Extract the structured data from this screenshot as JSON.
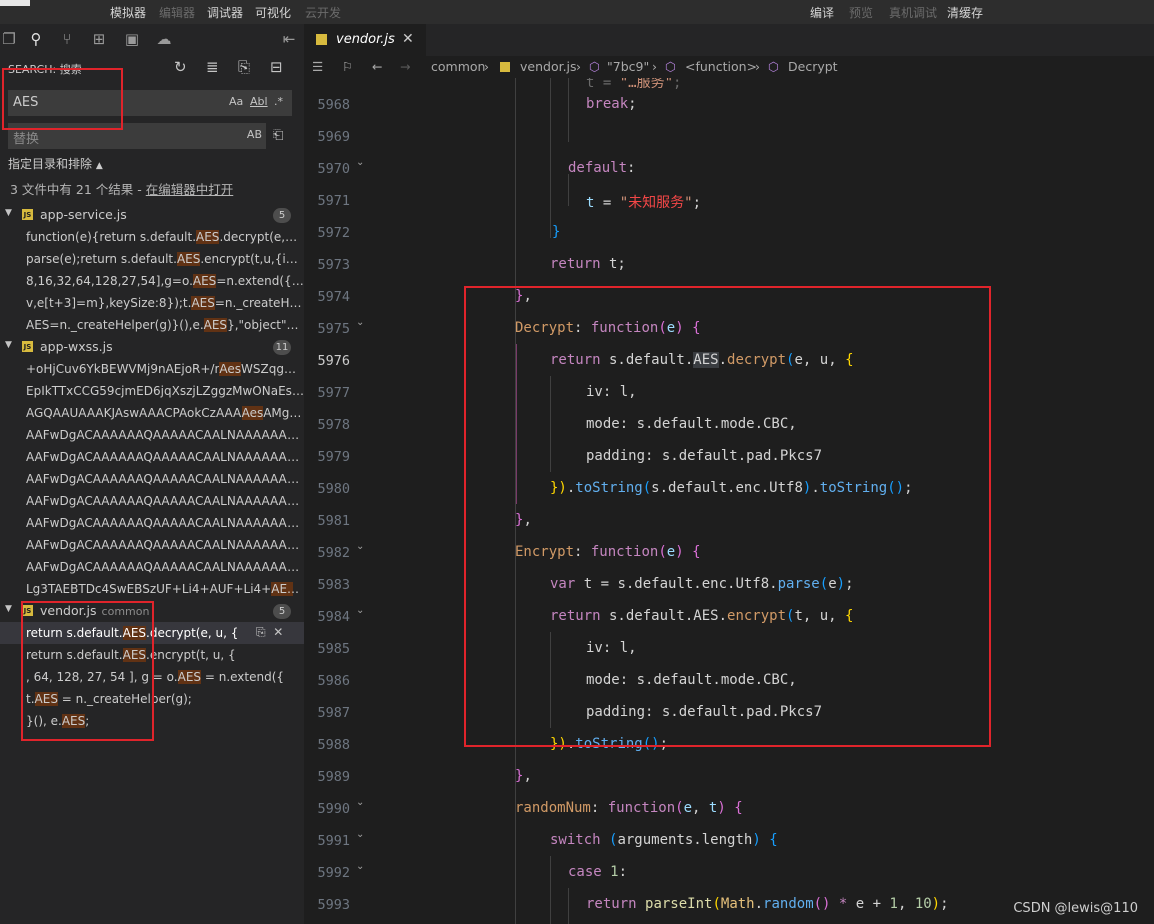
{
  "menubar": {
    "left": [
      {
        "label": "模拟器",
        "enabled": true
      },
      {
        "label": "编辑器",
        "enabled": false
      },
      {
        "label": "调试器",
        "enabled": true
      },
      {
        "label": "可视化",
        "enabled": true
      },
      {
        "label": "云开发",
        "enabled": false
      }
    ],
    "right": [
      {
        "label": "编译",
        "enabled": true
      },
      {
        "label": "预览",
        "enabled": false
      },
      {
        "label": "真机调试",
        "enabled": false
      },
      {
        "label": "清缓存",
        "enabled": true
      }
    ]
  },
  "sidebar": {
    "title": "SEARCH: 搜索",
    "search_value": "AES",
    "search_options": [
      "Aa",
      "Abl",
      ".*"
    ],
    "replace_placeholder": "替换",
    "replace_option": "AB",
    "include_exclude": "指定目录和排除",
    "summary_text": "3 文件中有 21 个结果 - ",
    "summary_link": "在编辑器中打开",
    "files": [
      {
        "name": "app-service.js",
        "dir": "",
        "count": "5",
        "results": [
          {
            "pre": "function(e){return s.default.",
            "hit": "AES",
            "post": ".decrypt(e,u,{iv:l,mode:s.default.mode.CBC"
          },
          {
            "pre": "parse(e);return s.default.",
            "hit": "AES",
            "post": ".encrypt(t,u,{iv:l,mode:s.default.mode.CBC"
          },
          {
            "pre": "8,16,32,64,128,27,54],g=o.",
            "hit": "AES",
            "post": "=n.extend({_doReset:function(){var e"
          },
          {
            "pre": "v,e[t+3]=m},keySize:8});t.",
            "hit": "AES",
            "post": "=n._createHelper(g)}(),e.AES},\"object\""
          },
          {
            "pre": "AES=n._createHelper(g)}(),e.",
            "hit": "AES",
            "post": "},\"object\"===s?e.exports=s.default"
          }
        ]
      },
      {
        "name": "app-wxss.js",
        "dir": "",
        "count": "11",
        "results": [
          {
            "pre": "+oHjCuv6YkBEWVMj9nAEjoR+/r",
            "hit": "Aes",
            "post": "WSZqgUhAAAAAAAA"
          },
          {
            "pre": "EpIkTTxCCG59cjmED6jqXszjLZggzMwONa",
            "hit": "",
            "post": "Esqlkj"
          },
          {
            "pre": "AGQAAUAAAKJAswAAACPAokCzAAA",
            "hit": "Aes",
            "post": "AMgEAAAAA"
          },
          {
            "pre": "AAFwDgACAAAAAAQAAAAACAALNAAAAAAAAAAAA",
            "hit": "",
            "post": ""
          },
          {
            "pre": "AAFwDgACAAAAAAQAAAAACAALNAAAAAAAAAAAA",
            "hit": "",
            "post": ""
          },
          {
            "pre": "AAFwDgACAAAAAAQAAAAACAALNAAAAAAAAAAAA",
            "hit": "",
            "post": ""
          },
          {
            "pre": "AAFwDgACAAAAAAQAAAAACAALNAAAAAAAAAAAA",
            "hit": "",
            "post": ""
          },
          {
            "pre": "AAFwDgACAAAAAAQAAAAACAALNAAAAAAAAAAAA",
            "hit": "",
            "post": ""
          },
          {
            "pre": "AAFwDgACAAAAAAQAAAAACAALNAAAAAAAAAAAA",
            "hit": "",
            "post": ""
          },
          {
            "pre": "AAFwDgACAAAAAAQAAAAACAALNAAAAAAAAAAAA",
            "hit": "",
            "post": ""
          },
          {
            "pre": "Lg3TAEBTDc4SwEBSzUF+Li4+AUF+Li4+",
            "hit": "AEs",
            "post": "AUDAAA"
          }
        ]
      },
      {
        "name": "vendor.js",
        "dir": "common",
        "count": "5",
        "results": [
          {
            "pre": "return s.default.",
            "hit": "AES",
            "post": ".decrypt(e, u, {"
          },
          {
            "pre": "return s.default.",
            "hit": "AES",
            "post": ".encrypt(t, u, {"
          },
          {
            "pre": ", 64, 128, 27, 54 ], g = o.",
            "hit": "AES",
            "post": " = n.extend({"
          },
          {
            "pre": "t.",
            "hit": "AES",
            "post": " = n._createHelper(g);"
          },
          {
            "pre": "}(), e.",
            "hit": "AES",
            "post": ";"
          }
        ]
      }
    ]
  },
  "editor": {
    "tab_name": "vendor.js",
    "breadcrumb": [
      "common",
      "vendor.js",
      "\"7bc9\"",
      "<function>",
      "Decrypt"
    ],
    "first_line": 5968,
    "current_line": 5976
  },
  "watermark": "CSDN @lewis@110",
  "colors": {
    "highlight_box": "#e0242b",
    "match_bg": "#613214"
  }
}
